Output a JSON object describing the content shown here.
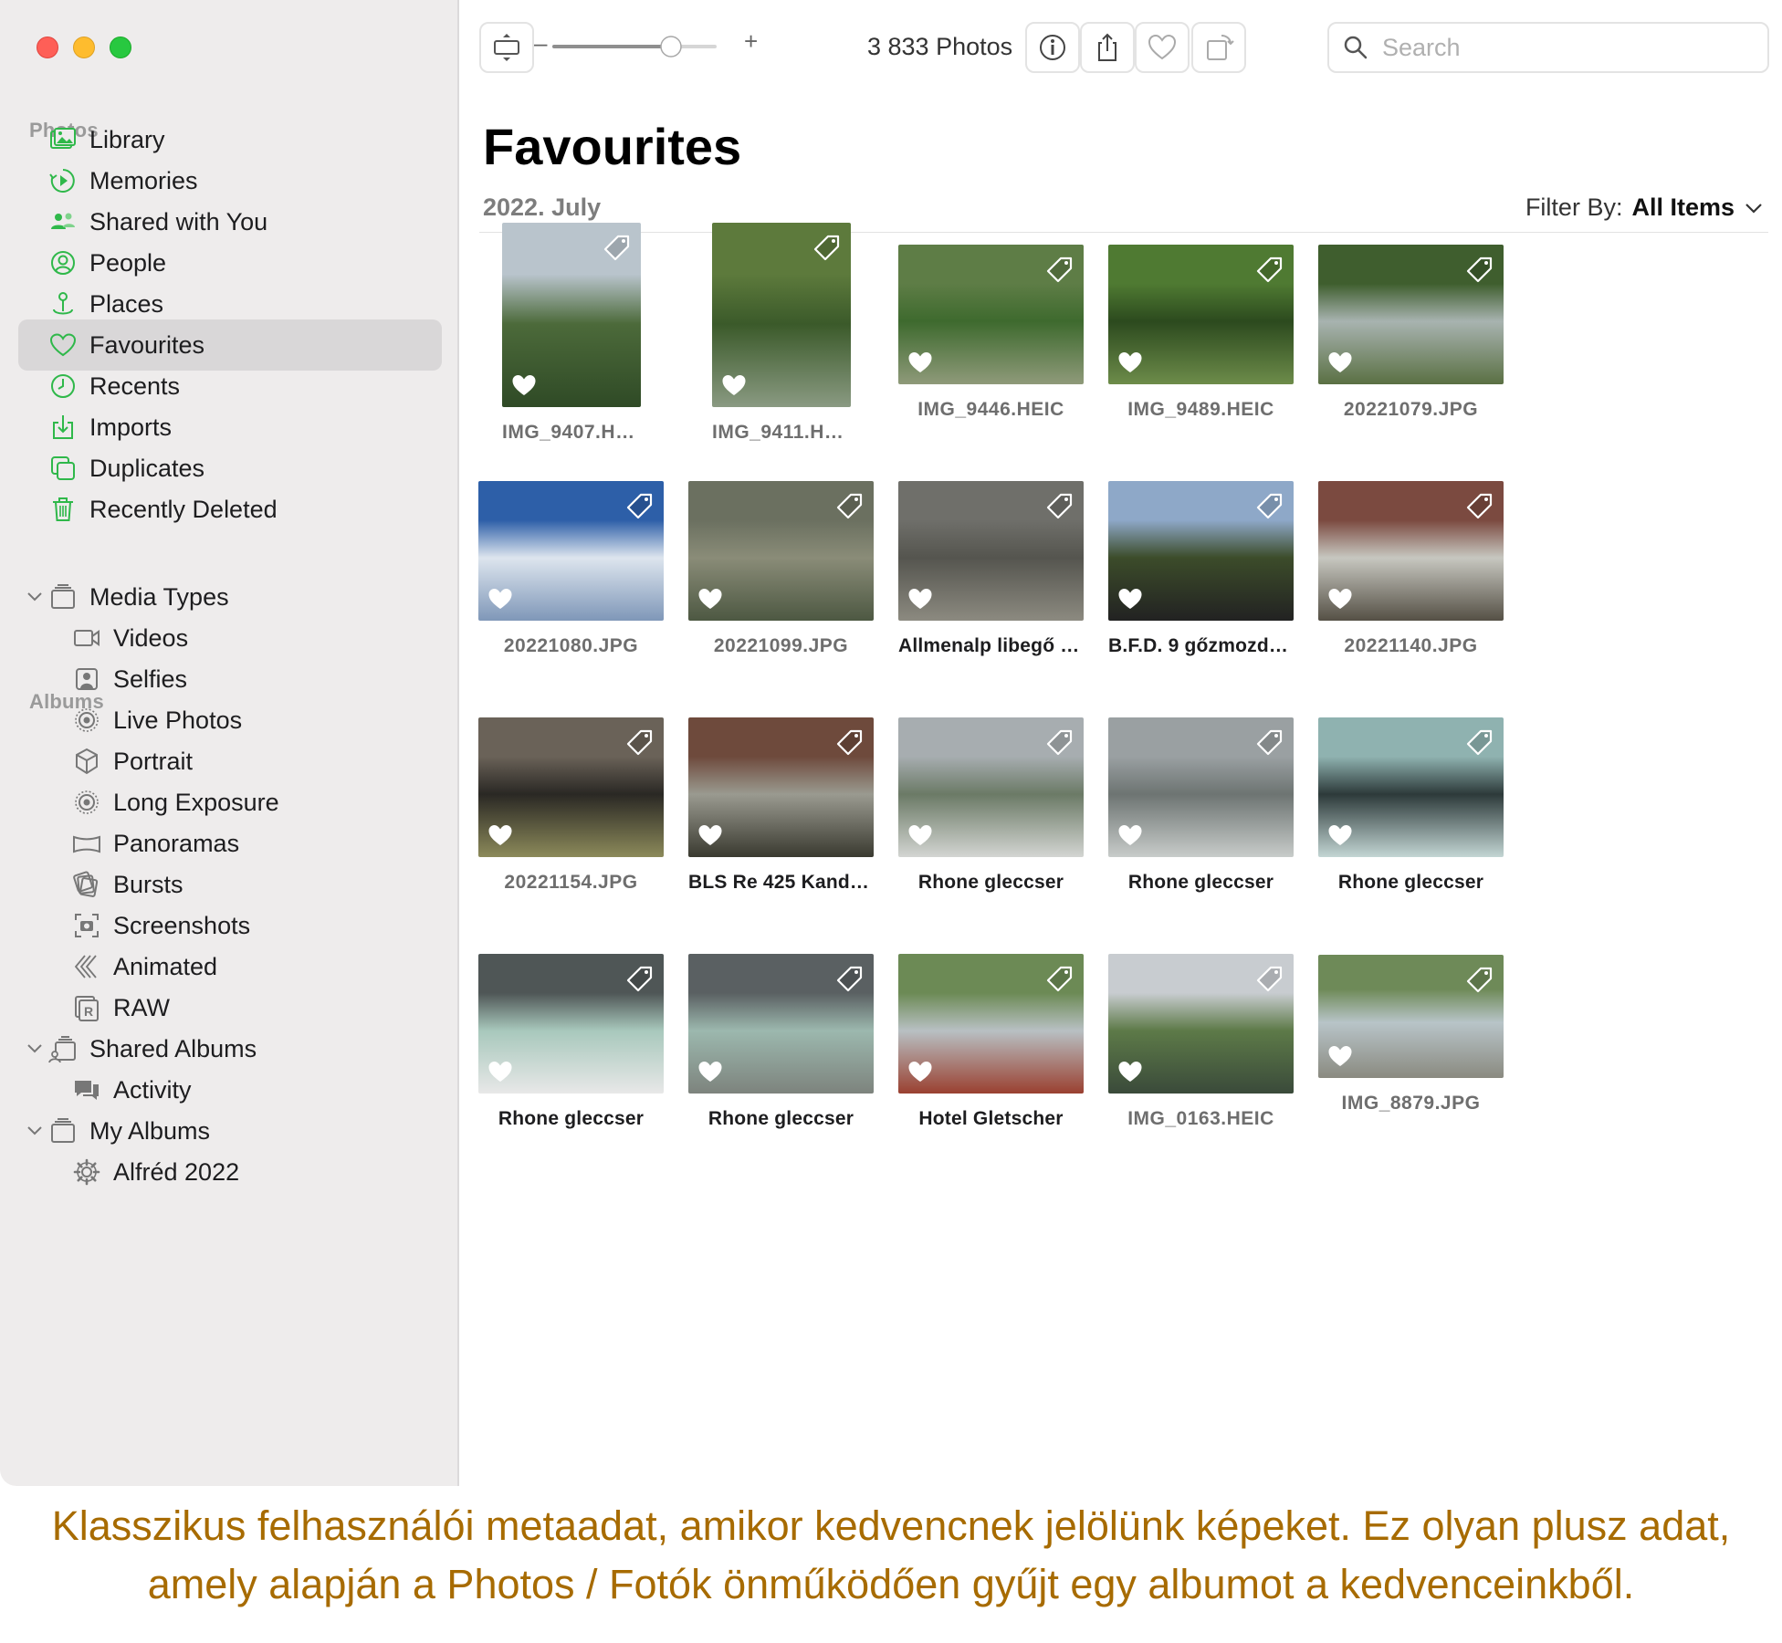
{
  "sidebar": {
    "photos_section": "Photos",
    "albums_section": "Albums",
    "items": [
      {
        "label": "Library",
        "icon": "library-icon"
      },
      {
        "label": "Memories",
        "icon": "memories-icon"
      },
      {
        "label": "Shared with You",
        "icon": "shared-with-you-icon"
      },
      {
        "label": "People",
        "icon": "people-icon"
      },
      {
        "label": "Places",
        "icon": "places-icon"
      },
      {
        "label": "Favourites",
        "icon": "heart-icon",
        "selected": true
      },
      {
        "label": "Recents",
        "icon": "clock-icon"
      },
      {
        "label": "Imports",
        "icon": "import-icon"
      },
      {
        "label": "Duplicates",
        "icon": "duplicates-icon"
      },
      {
        "label": "Recently Deleted",
        "icon": "trash-icon"
      }
    ],
    "media_types": {
      "label": "Media Types",
      "items": [
        "Videos",
        "Selfies",
        "Live Photos",
        "Portrait",
        "Long Exposure",
        "Panoramas",
        "Bursts",
        "Screenshots",
        "Animated",
        "RAW"
      ]
    },
    "shared_albums": {
      "label": "Shared Albums",
      "items": [
        "Activity"
      ]
    },
    "my_albums": {
      "label": "My Albums",
      "items": [
        "Alfréd 2022"
      ]
    }
  },
  "toolbar": {
    "slider_minus": "–",
    "slider_plus": "+",
    "slider_value": 0.75,
    "photo_count": "3 833 Photos",
    "search_placeholder": "Search"
  },
  "main": {
    "title": "Favourites",
    "date": "2022. July",
    "filter_label": "Filter By:",
    "filter_value": "All Items"
  },
  "photos": [
    {
      "caption": "IMG_9407.HEIC",
      "dark": false,
      "colors": [
        "#b9c4cc",
        "#4c6a3a",
        "#2f4a26"
      ]
    },
    {
      "caption": "IMG_9411.HEIC",
      "dark": false,
      "colors": [
        "#5d7a3c",
        "#3b5a2a",
        "#8a9a82"
      ]
    },
    {
      "caption": "IMG_9446.HEIC",
      "dark": false,
      "colors": [
        "#5e7d46",
        "#3e6a2e",
        "#8f9a7a"
      ]
    },
    {
      "caption": "IMG_9489.HEIC",
      "dark": false,
      "colors": [
        "#4f7a32",
        "#2c4a1e",
        "#6d8c4a"
      ]
    },
    {
      "caption": "20221079.JPG",
      "dark": false,
      "colors": [
        "#3f5e2e",
        "#a8b3b0",
        "#5a7043"
      ]
    },
    {
      "caption": "20221080.JPG",
      "dark": false,
      "colors": [
        "#2d5fa8",
        "#dde5ee",
        "#7f97b8"
      ]
    },
    {
      "caption": "20221099.JPG",
      "dark": false,
      "colors": [
        "#6b7060",
        "#8a8c78",
        "#4d5842"
      ]
    },
    {
      "caption": "Allmenalp libegő Kan...",
      "dark": true,
      "colors": [
        "#6f6f6a",
        "#55554f",
        "#8c8a80"
      ]
    },
    {
      "caption": "B.F.D. 9 gőzmozdony...",
      "dark": true,
      "colors": [
        "#8ea8c8",
        "#3c4c2a",
        "#222222"
      ]
    },
    {
      "caption": "20221140.JPG",
      "dark": false,
      "colors": [
        "#7b4a40",
        "#c7c7c0",
        "#555045"
      ]
    },
    {
      "caption": "20221154.JPG",
      "dark": false,
      "colors": [
        "#6a6258",
        "#2a2824",
        "#8c8a5a"
      ]
    },
    {
      "caption": "BLS Re 425 Kanderst...",
      "dark": true,
      "colors": [
        "#6e4a3c",
        "#9a9a90",
        "#3a3a30"
      ]
    },
    {
      "caption": "Rhone gleccser",
      "dark": true,
      "colors": [
        "#a7adb0",
        "#6b7a66",
        "#d3d5d2"
      ]
    },
    {
      "caption": "Rhone gleccser",
      "dark": true,
      "colors": [
        "#9aa0a2",
        "#6d7472",
        "#c8ccca"
      ]
    },
    {
      "caption": "Rhone gleccser",
      "dark": true,
      "colors": [
        "#8fb2b0",
        "#2d3a3a",
        "#c3d6d4"
      ]
    },
    {
      "caption": "Rhone gleccser",
      "dark": true,
      "colors": [
        "#4f5656",
        "#a8c8bc",
        "#e8e8e8"
      ]
    },
    {
      "caption": "Rhone gleccser",
      "dark": true,
      "colors": [
        "#5a6062",
        "#9cb8ae",
        "#7d837d"
      ]
    },
    {
      "caption": "Hotel Gletscher",
      "dark": true,
      "colors": [
        "#6c8a55",
        "#b8c0c3",
        "#9a4030"
      ]
    },
    {
      "caption": "IMG_0163.HEIC",
      "dark": false,
      "colors": [
        "#c8ccd0",
        "#5d7a48",
        "#3a4a3a"
      ]
    },
    {
      "caption": "IMG_8879.JPG",
      "dark": false,
      "colors": [
        "#6e8a58",
        "#b8c4c8",
        "#8a8a80"
      ]
    }
  ],
  "footer": {
    "text": "Klasszikus felhasználói metaadat, amikor kedvencnek jelölünk képeket. Ez olyan plusz adat, amely alapján a Photos / Fotók önműködően gyűjt egy albumot a kedvenceinkből."
  },
  "colors": {
    "accent_green": "#2fb84a",
    "caption_footer": "#a76b00",
    "sidebar_bg": "#eeecec",
    "selected_bg": "#d9d7d8"
  }
}
